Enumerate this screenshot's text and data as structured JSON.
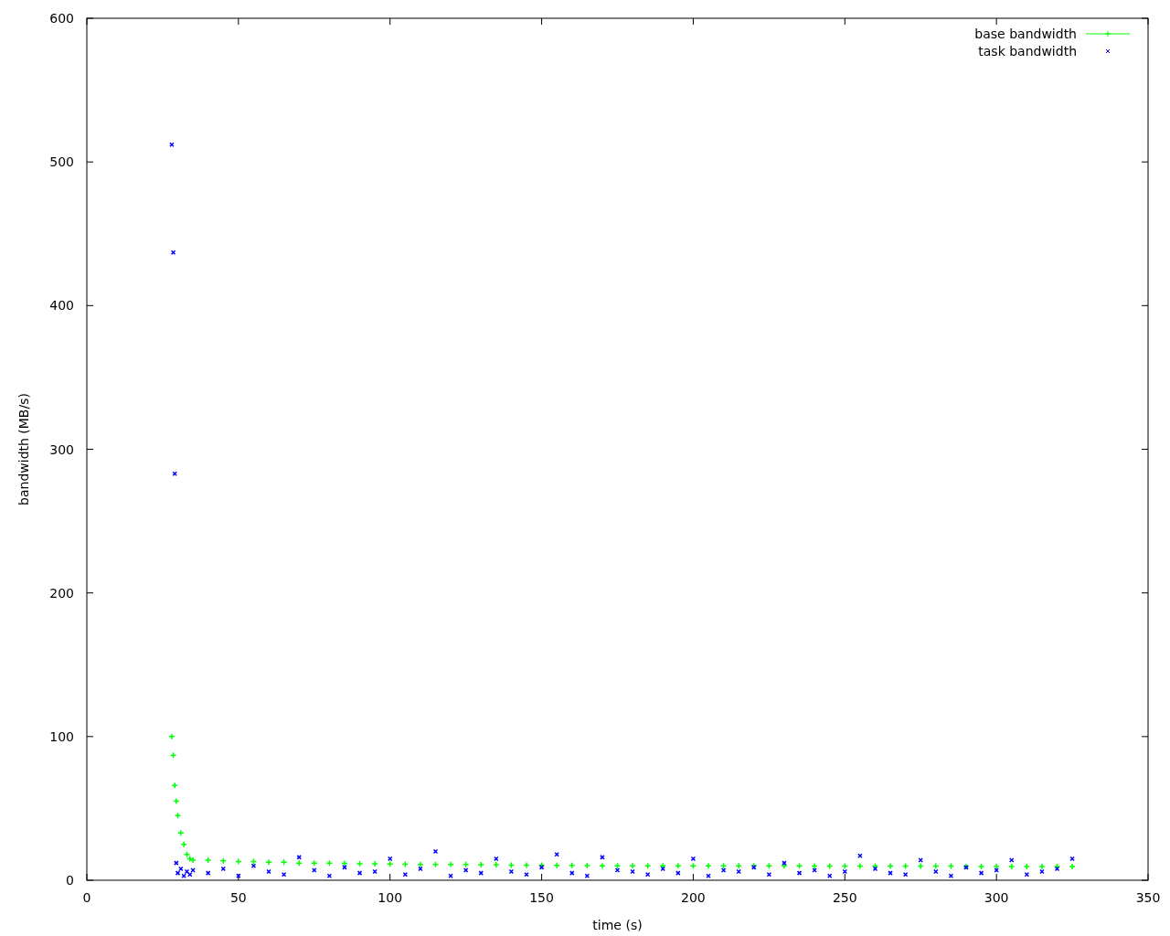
{
  "chart_data": {
    "type": "scatter",
    "legend": true,
    "xlabel": "time (s)",
    "ylabel": "bandwidth (MB/s)",
    "xlim": [
      0,
      350
    ],
    "ylim": [
      0,
      600
    ],
    "xticks": [
      0,
      50,
      100,
      150,
      200,
      250,
      300,
      350
    ],
    "yticks": [
      0,
      100,
      200,
      300,
      400,
      500,
      600
    ],
    "x": [
      28,
      28.5,
      29,
      29.5,
      30,
      31,
      32,
      33,
      34,
      35,
      40,
      45,
      50,
      55,
      60,
      65,
      70,
      75,
      80,
      85,
      90,
      95,
      100,
      105,
      110,
      115,
      120,
      125,
      130,
      135,
      140,
      145,
      150,
      155,
      160,
      165,
      170,
      175,
      180,
      185,
      190,
      195,
      200,
      205,
      210,
      215,
      220,
      225,
      230,
      235,
      240,
      245,
      250,
      255,
      260,
      265,
      270,
      275,
      280,
      285,
      290,
      295,
      300,
      305,
      310,
      315,
      320,
      325
    ],
    "series": [
      {
        "name": "base bandwidth",
        "color": "#00ff00",
        "values": [
          100,
          87,
          66,
          55,
          45,
          33,
          25,
          18,
          15,
          14,
          14,
          13.5,
          13,
          13,
          12.5,
          12.5,
          12,
          12,
          12,
          11.8,
          11.5,
          11.5,
          11.3,
          11.2,
          11,
          11,
          11,
          11,
          10.8,
          10.8,
          10.5,
          10.5,
          10.5,
          10.3,
          10.3,
          10.2,
          10,
          10,
          10,
          10,
          10,
          10,
          10,
          10,
          10,
          10,
          10,
          10,
          10,
          10,
          9.8,
          9.8,
          9.8,
          9.8,
          9.8,
          9.8,
          9.8,
          9.8,
          9.8,
          9.8,
          9.5,
          9.5,
          9.5,
          9.5,
          9.5,
          9.5,
          9.5,
          9.5
        ]
      },
      {
        "name": "task bandwidth",
        "color": "#0000ff",
        "values": [
          512,
          437,
          283,
          12,
          5,
          8,
          3,
          6,
          4,
          7,
          5,
          8,
          3,
          10,
          6,
          4,
          16,
          7,
          3,
          9,
          5,
          6,
          15,
          4,
          8,
          20,
          3,
          7,
          5,
          15,
          6,
          4,
          9,
          18,
          5,
          3,
          16,
          7,
          6,
          4,
          8,
          5,
          15,
          3,
          7,
          6,
          9,
          4,
          12,
          5,
          7,
          3,
          6,
          17,
          8,
          5,
          4,
          14,
          6,
          3,
          9,
          5,
          7,
          14,
          4,
          6,
          8,
          15
        ]
      }
    ]
  }
}
